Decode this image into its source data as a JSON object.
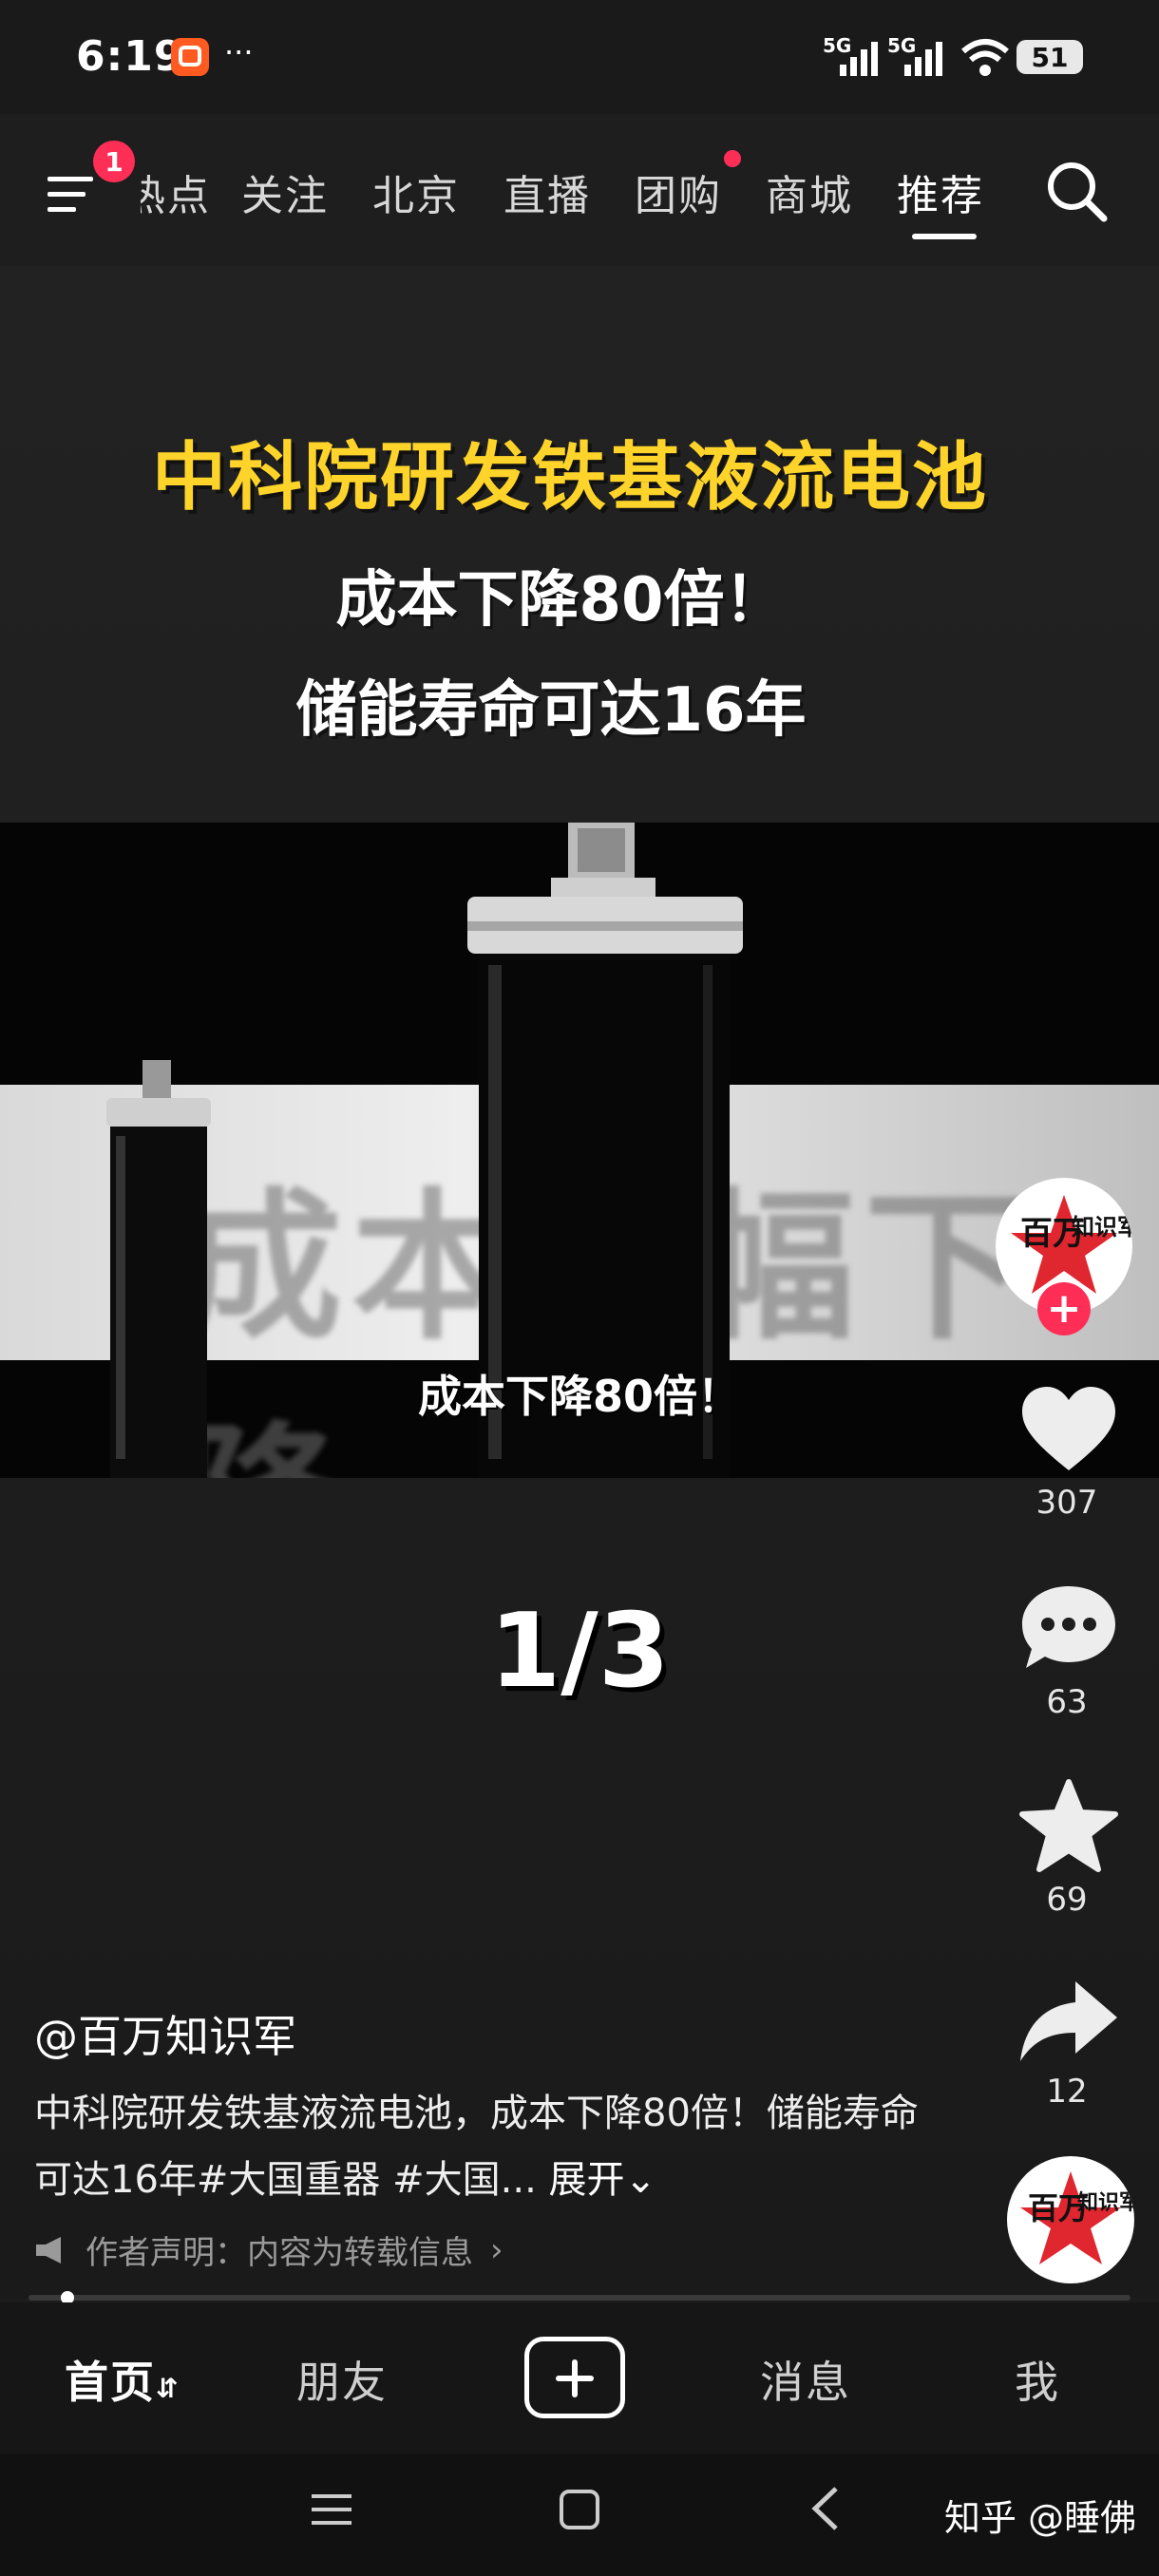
{
  "status_bar": {
    "time": "6:19",
    "net1": "5G",
    "net2": "5G",
    "battery": "51"
  },
  "top_nav": {
    "menu_badge": "1",
    "tabs": [
      "热点",
      "关注",
      "北京",
      "直播",
      "团购",
      "商城",
      "推荐"
    ],
    "active_tab": "推荐"
  },
  "video": {
    "headline": "中科院研发铁基液流电池",
    "subline1": "成本下降80倍！",
    "subline2": "储能寿命可达16年",
    "band_text": "成本大幅下降",
    "frame_caption": "成本下降80倍！",
    "page_counter": "1/3"
  },
  "actions": {
    "likes": "307",
    "comments": "63",
    "favorites": "69",
    "shares": "12"
  },
  "avatar_text": {
    "line1": "百万",
    "line2": "知识军"
  },
  "caption": {
    "author": "@百万知识军",
    "description": "中科院研发铁基液流电池，成本下降80倍！储能寿命可达16年#大国重器 #大国...",
    "expand": "展开",
    "statement": "作者声明：内容为转载信息"
  },
  "progress": {
    "fraction": 0.02
  },
  "bottom_nav": {
    "home": "首页",
    "friends": "朋友",
    "messages": "消息",
    "me": "我"
  },
  "watermark": "知乎 @睡佛",
  "colors": {
    "accent": "#ff2e57",
    "headline": "#ffd42a"
  }
}
